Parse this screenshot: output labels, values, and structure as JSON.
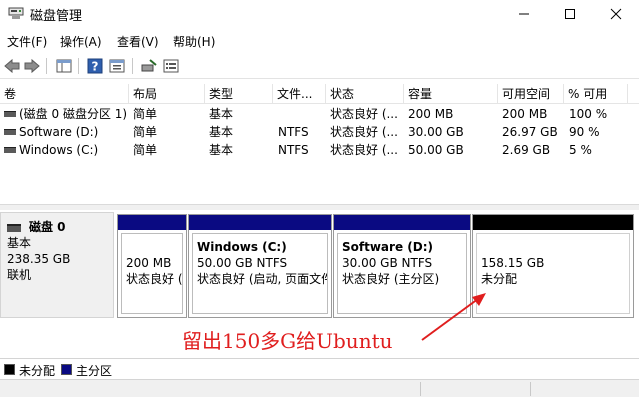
{
  "window": {
    "title": "磁盘管理"
  },
  "menu": [
    "文件(F)",
    "操作(A)",
    "查看(V)",
    "帮助(H)"
  ],
  "volume_table": {
    "columns": [
      "卷",
      "布局",
      "类型",
      "文件...",
      "状态",
      "容量",
      "可用空间",
      "% 可用"
    ],
    "rows": [
      {
        "volume": "(磁盘 0 磁盘分区 1)",
        "layout": "简单",
        "type": "基本",
        "fs": "",
        "status": "状态良好 (...",
        "capacity": "200 MB",
        "free": "200 MB",
        "pct": "100 %"
      },
      {
        "volume": "Software (D:)",
        "layout": "简单",
        "type": "基本",
        "fs": "NTFS",
        "status": "状态良好 (...",
        "capacity": "30.00 GB",
        "free": "26.97 GB",
        "pct": "90 %"
      },
      {
        "volume": "Windows (C:)",
        "layout": "简单",
        "type": "基本",
        "fs": "NTFS",
        "status": "状态良好 (...",
        "capacity": "50.00 GB",
        "free": "2.69 GB",
        "pct": "5 %"
      }
    ]
  },
  "disk": {
    "name": "磁盘 0",
    "type": "基本",
    "size": "238.35 GB",
    "status": "联机"
  },
  "partitions": [
    {
      "name": "",
      "size": "200 MB",
      "status": "状态良好 (",
      "kind": "primary"
    },
    {
      "name": "Windows  (C:)",
      "size": "50.00 GB NTFS",
      "status": "状态良好 (启动, 页面文件",
      "kind": "primary"
    },
    {
      "name": "Software  (D:)",
      "size": "30.00 GB NTFS",
      "status": "状态良好 (主分区)",
      "kind": "primary"
    },
    {
      "name": "",
      "size": "158.15 GB",
      "status": "未分配",
      "kind": "unallocated"
    }
  ],
  "legend": {
    "unallocated": "未分配",
    "primary": "主分区"
  },
  "annotation": {
    "text": "留出150多G给Ubuntu"
  },
  "colors": {
    "primary_partition": "#0a0a82",
    "unallocated": "#000000",
    "annotation": "#e01e1e"
  }
}
